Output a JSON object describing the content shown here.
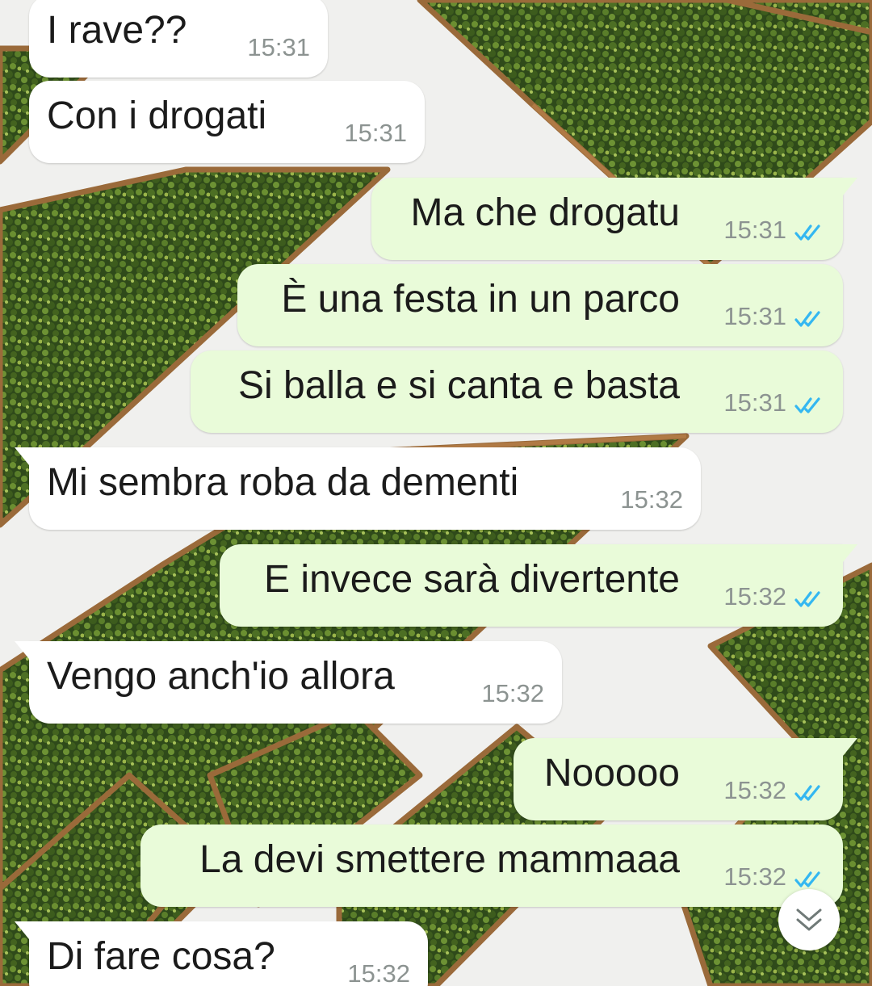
{
  "colors": {
    "incoming_bubble": "#ffffff",
    "outgoing_bubble": "#e9fbd9",
    "read_ticks": "#34b7f1",
    "timestamp": "#8c9391"
  },
  "wallpaper": {
    "description_icon": "boxwood-hedge-chevron-wallpaper"
  },
  "messages": [
    {
      "direction": "in",
      "text": "I rave??",
      "time": "15:31"
    },
    {
      "direction": "in",
      "text": "Con i drogati",
      "time": "15:31"
    },
    {
      "direction": "out",
      "text": "Ma che drogatu",
      "time": "15:31",
      "status": "read"
    },
    {
      "direction": "out",
      "text": "È una festa in un parco",
      "time": "15:31",
      "status": "read"
    },
    {
      "direction": "out",
      "text": "Si balla e si canta e basta",
      "time": "15:31",
      "status": "read"
    },
    {
      "direction": "in",
      "text": "Mi sembra roba da dementi",
      "time": "15:32"
    },
    {
      "direction": "out",
      "text": "E invece sarà divertente",
      "time": "15:32",
      "status": "read"
    },
    {
      "direction": "in",
      "text": "Vengo anch'io allora",
      "time": "15:32"
    },
    {
      "direction": "out",
      "text": "Nooooo",
      "time": "15:32",
      "status": "read"
    },
    {
      "direction": "out",
      "text": "La devi smettere mammaaa",
      "time": "15:32",
      "status": "read"
    },
    {
      "direction": "in",
      "text": "Di fare cosa?",
      "time": "15:32"
    }
  ],
  "scroll_button": {
    "icon": "double-chevron-down-icon"
  }
}
